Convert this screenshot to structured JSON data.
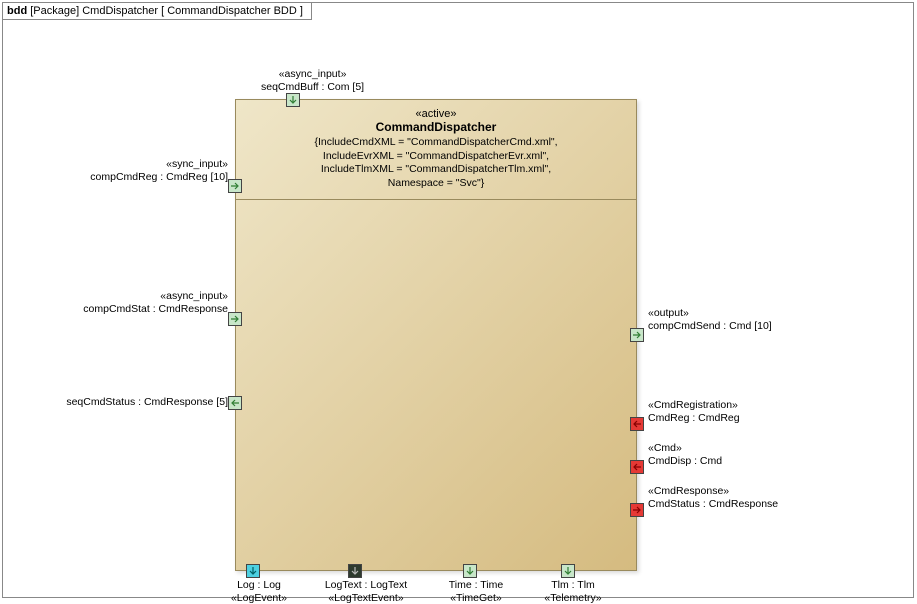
{
  "frame": {
    "kind": "bdd",
    "pkg": "[Package]",
    "name": "CmdDispatcher",
    "title": "[ CommandDispatcher BDD ]"
  },
  "block": {
    "stereotype": "«active»",
    "name": "CommandDispatcher",
    "props": "{IncludeCmdXML = \"CommandDispatcherCmd.xml\",\nIncludeEvrXML = \"CommandDispatcherEvr.xml\",\nIncludeTlmXML = \"CommandDispatcherTlm.xml\",\nNamespace = \"Svc\"}"
  },
  "ports": {
    "seqCmdBuff": {
      "stereo": "«async_input»",
      "label": "seqCmdBuff : Com [5]"
    },
    "compCmdReg": {
      "stereo": "«sync_input»",
      "label": "compCmdReg : CmdReg [10]"
    },
    "compCmdStat": {
      "stereo": "«async_input»",
      "label": "compCmdStat : CmdResponse"
    },
    "seqCmdStatus": {
      "label": "seqCmdStatus : CmdResponse [5]"
    },
    "compCmdSend": {
      "stereo": "«output»",
      "label": "compCmdSend : Cmd [10]"
    },
    "cmdReg": {
      "stereo": "«CmdRegistration»",
      "label": "CmdReg : CmdReg"
    },
    "cmdDisp": {
      "stereo": "«Cmd»",
      "label": "CmdDisp : Cmd"
    },
    "cmdStatus": {
      "stereo": "«CmdResponse»",
      "label": "CmdStatus : CmdResponse"
    },
    "log": {
      "label": "Log : Log",
      "stereo": "«LogEvent»"
    },
    "logText": {
      "label": "LogText : LogText",
      "stereo": "«LogTextEvent»"
    },
    "time": {
      "label": "Time : Time",
      "stereo": "«TimeGet»"
    },
    "tlm": {
      "label": "Tlm : Tlm",
      "stereo": "«Telemetry»"
    }
  }
}
